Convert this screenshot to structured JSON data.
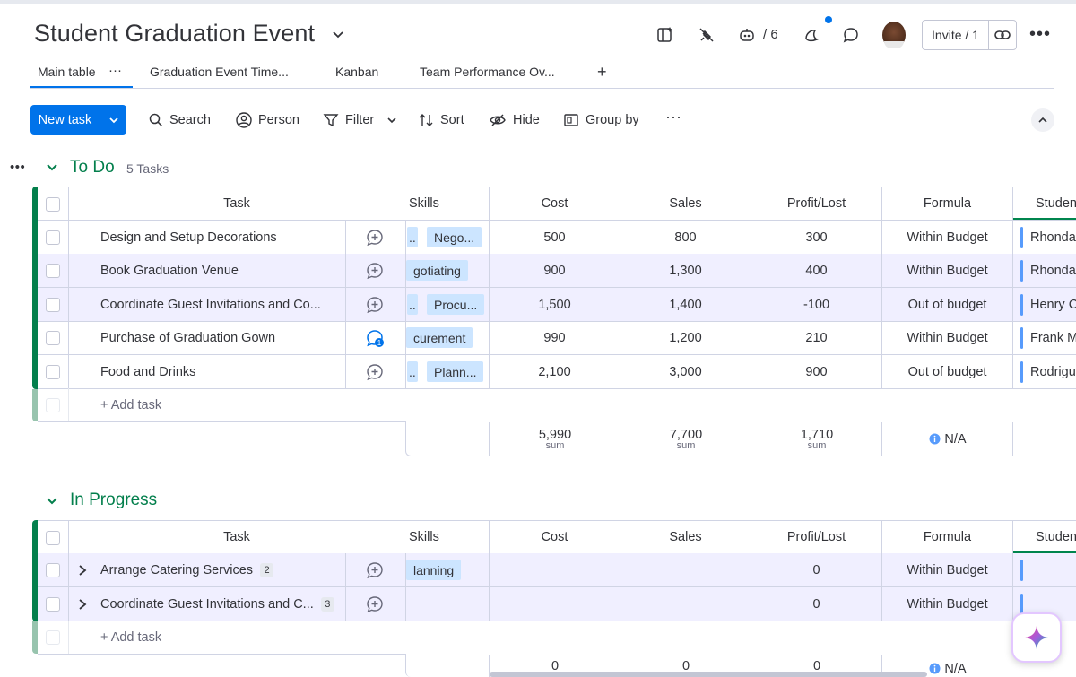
{
  "header": {
    "title": "Student Graduation Event",
    "automations_count": "/ 6",
    "invite_label": "Invite / 1"
  },
  "tabs": [
    {
      "label": "Main table"
    },
    {
      "label": "Graduation Event Time..."
    },
    {
      "label": "Kanban"
    },
    {
      "label": "Team Performance Ov..."
    }
  ],
  "toolbar": {
    "new_task": "New task",
    "search": "Search",
    "person": "Person",
    "filter": "Filter",
    "sort": "Sort",
    "hide": "Hide",
    "group_by": "Group by"
  },
  "columns": {
    "task": "Task",
    "skills": "Skills",
    "cost": "Cost",
    "sales": "Sales",
    "profit": "Profit/Lost",
    "formula": "Formula",
    "student": "Studen"
  },
  "groups": [
    {
      "title": "To Do",
      "count": "5 Tasks",
      "color": "#037f4c",
      "rows": [
        {
          "task": "Design and Setup Decorations",
          "skill": "Nego...",
          "skill_prefix": "..",
          "cost": "500",
          "sales": "800",
          "profit": "300",
          "formula": "Within Budget",
          "student": "Rhonda",
          "updates": ""
        },
        {
          "task": "Book Graduation Venue",
          "skill": "gotiating",
          "skill_prefix": "",
          "cost": "900",
          "sales": "1,300",
          "profit": "400",
          "formula": "Within Budget",
          "student": "Rhonda",
          "updates": ""
        },
        {
          "task": "Coordinate Guest Invitations and Co...",
          "skill": "Procu...",
          "skill_prefix": "..",
          "cost": "1,500",
          "sales": "1,400",
          "profit": "-100",
          "formula": "Out of budget",
          "student": "Henry C",
          "updates": ""
        },
        {
          "task": "Purchase of Graduation Gown",
          "skill": "curement",
          "skill_prefix": "",
          "cost": "990",
          "sales": "1,200",
          "profit": "210",
          "formula": "Within Budget",
          "student": "Frank M",
          "updates": "1"
        },
        {
          "task": "Food and Drinks",
          "skill": "Plann...",
          "skill_prefix": "..",
          "cost": "2,100",
          "sales": "3,000",
          "profit": "900",
          "formula": "Out of budget",
          "student": "Rodrigu",
          "updates": ""
        }
      ],
      "add_task": "+ Add task",
      "summary": {
        "cost": "5,990",
        "sales": "7,700",
        "profit": "1,710",
        "formula": "N/A",
        "sum_label": "sum"
      }
    },
    {
      "title": "In Progress",
      "count": "",
      "color": "#037f4c",
      "rows": [
        {
          "task": "Arrange Catering Services",
          "subitems": "2",
          "skill": "lanning",
          "cost": "",
          "sales": "",
          "profit": "0",
          "formula": "Within Budget",
          "student": ""
        },
        {
          "task": "Coordinate Guest Invitations and C...",
          "subitems": "3",
          "skill": "",
          "cost": "",
          "sales": "",
          "profit": "0",
          "formula": "Within Budget",
          "student": ""
        }
      ],
      "add_task": "+ Add task",
      "summary": {
        "cost": "0",
        "sales": "0",
        "profit": "0",
        "formula": "N/A"
      }
    }
  ]
}
